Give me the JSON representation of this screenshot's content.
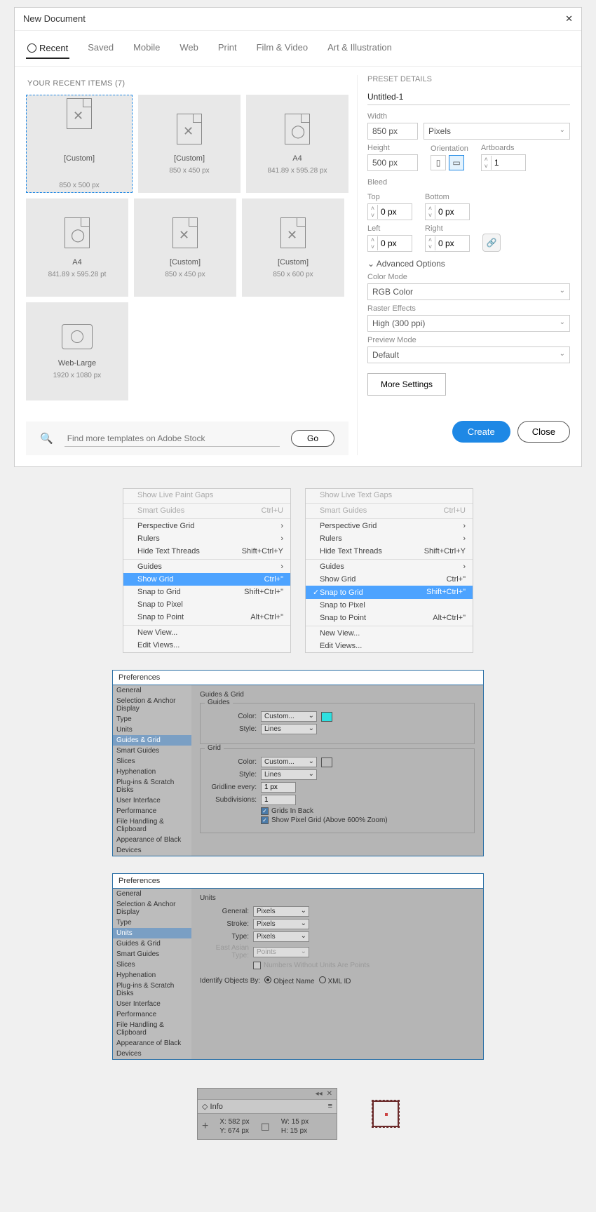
{
  "dialog": {
    "title": "New Document",
    "tabs": [
      "Recent",
      "Saved",
      "Mobile",
      "Web",
      "Print",
      "Film & Video",
      "Art & Illustration"
    ],
    "recent_label": "YOUR RECENT ITEMS  (7)",
    "cards": [
      {
        "name": "[Custom]",
        "dim": "850 x 500 px"
      },
      {
        "name": "[Custom]",
        "dim": "850 x 450 px"
      },
      {
        "name": "A4",
        "dim": "841.89 x 595.28 px"
      },
      {
        "name": "A4",
        "dim": "841.89 x 595.28 pt"
      },
      {
        "name": "[Custom]",
        "dim": "850 x 450 px"
      },
      {
        "name": "[Custom]",
        "dim": "850 x 600 px"
      },
      {
        "name": "Web-Large",
        "dim": "1920 x 1080 px"
      }
    ],
    "search_placeholder": "Find more templates on Adobe Stock",
    "go": "Go",
    "preset_details": "PRESET DETAILS",
    "doc_name": "Untitled-1",
    "width_lbl": "Width",
    "width": "850 px",
    "units": "Pixels",
    "height_lbl": "Height",
    "height": "500 px",
    "orient_lbl": "Orientation",
    "art_lbl": "Artboards",
    "artboards": "1",
    "bleed_lbl": "Bleed",
    "top": "Top",
    "bottom": "Bottom",
    "left": "Left",
    "right_l": "Right",
    "b_top": "0 px",
    "b_bot": "0 px",
    "b_left": "0 px",
    "b_right": "0 px",
    "adv": "Advanced Options",
    "color_mode_lbl": "Color Mode",
    "color_mode": "RGB Color",
    "raster_lbl": "Raster Effects",
    "raster": "High (300 ppi)",
    "preview_lbl": "Preview Mode",
    "preview": "Default",
    "more": "More Settings",
    "create": "Create",
    "close": "Close"
  },
  "menu1": {
    "items": [
      {
        "l": "Show Live Paint Gaps",
        "s": "",
        "dim": true
      },
      {
        "l": "Smart Guides",
        "s": "Ctrl+U",
        "dim": true,
        "sep": true
      },
      {
        "l": "Perspective Grid",
        "s": "›",
        "sep": true
      },
      {
        "l": "Rulers",
        "s": "›"
      },
      {
        "l": "Hide Text Threads",
        "s": "Shift+Ctrl+Y"
      },
      {
        "l": "Guides",
        "s": "›",
        "sep": true
      },
      {
        "l": "Show Grid",
        "s": "Ctrl+\"",
        "hl": true
      },
      {
        "l": "Snap to Grid",
        "s": "Shift+Ctrl+\""
      },
      {
        "l": "Snap to Pixel",
        "s": ""
      },
      {
        "l": "Snap to Point",
        "s": "Alt+Ctrl+\""
      },
      {
        "l": "New View...",
        "s": "",
        "sep": true
      },
      {
        "l": "Edit Views...",
        "s": ""
      }
    ]
  },
  "menu2": {
    "items": [
      {
        "l": "Show Live Text Gaps",
        "s": "",
        "dim": true
      },
      {
        "l": "Smart Guides",
        "s": "Ctrl+U",
        "dim": true,
        "sep": true
      },
      {
        "l": "Perspective Grid",
        "s": "›",
        "sep": true
      },
      {
        "l": "Rulers",
        "s": "›"
      },
      {
        "l": "Hide Text Threads",
        "s": "Shift+Ctrl+Y"
      },
      {
        "l": "Guides",
        "s": "›",
        "sep": true
      },
      {
        "l": "Show Grid",
        "s": "Ctrl+\""
      },
      {
        "l": "Snap to Grid",
        "s": "Shift+Ctrl+\"",
        "hl": true,
        "chk": true
      },
      {
        "l": "Snap to Pixel",
        "s": ""
      },
      {
        "l": "Snap to Point",
        "s": "Alt+Ctrl+\""
      },
      {
        "l": "New View...",
        "s": "",
        "sep": true
      },
      {
        "l": "Edit Views...",
        "s": ""
      }
    ]
  },
  "pref_side": [
    "General",
    "Selection & Anchor Display",
    "Type",
    "Units",
    "Guides & Grid",
    "Smart Guides",
    "Slices",
    "Hyphenation",
    "Plug-ins & Scratch Disks",
    "User Interface",
    "Performance",
    "File Handling & Clipboard",
    "Appearance of Black",
    "Devices"
  ],
  "pref1": {
    "title": "Preferences",
    "panel": "Guides & Grid",
    "guides_color": "Custom...",
    "guides_style": "Lines",
    "grid_color": "Custom...",
    "grid_style": "Lines",
    "gridline": "1 px",
    "subdiv": "1",
    "cb1": "Grids In Back",
    "cb2": "Show Pixel Grid (Above 600% Zoom)",
    "leg_guides": "Guides",
    "leg_grid": "Grid",
    "color_lbl": "Color:",
    "style_lbl": "Style:",
    "gridline_lbl": "Gridline every:",
    "subdiv_lbl": "Subdivisions:"
  },
  "pref2": {
    "title": "Preferences",
    "panel": "Units",
    "general": "Pixels",
    "stroke": "Pixels",
    "type": "Pixels",
    "la": "Points",
    "general_lbl": "General:",
    "stroke_lbl": "Stroke:",
    "type_lbl": "Type:",
    "la_lbl": "East Asian Type:",
    "num_lbl": "Numbers Without Units Are Points",
    "identify": "Identify Objects By:",
    "r1": "Object Name",
    "r2": "XML ID"
  },
  "info": {
    "tab": "Info",
    "x_lbl": "X:",
    "y_lbl": "Y:",
    "w_lbl": "W:",
    "h_lbl": "H:",
    "x": "582 px",
    "y": "674 px",
    "w": "15 px",
    "h": "15 px"
  }
}
